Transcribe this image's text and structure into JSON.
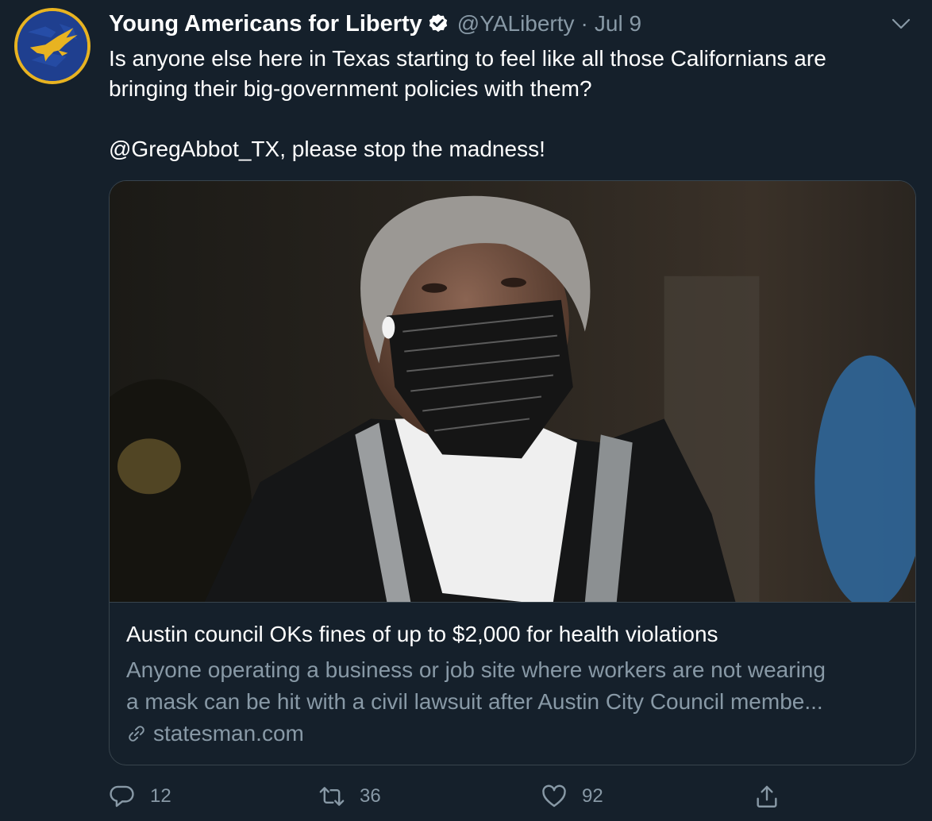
{
  "author": {
    "display_name": "Young Americans for Liberty",
    "handle": "@YALiberty",
    "separator": "·",
    "date": "Jul 9"
  },
  "tweet": {
    "lines": [
      "Is anyone else here in Texas starting to feel like all those Californians are",
      "bringing their big-government policies with them?",
      "@GregAbbot_TX, please stop the madness!"
    ]
  },
  "card": {
    "title": "Austin council OKs fines of up to $2,000 for health violations",
    "description_lines": [
      "Anyone operating a business or job site where workers are not wearing",
      "a mask can be hit with a civil lawsuit after Austin City Council membe..."
    ],
    "domain": "statesman.com"
  },
  "actions": {
    "reply_count": "12",
    "retweet_count": "36",
    "like_count": "92"
  },
  "colors": {
    "background": "#15202b",
    "text_primary": "#ffffff",
    "text_secondary": "#8899a6",
    "border": "#38444d",
    "verified": "#ffffff"
  },
  "icons": {
    "avatar": "eagle-logo",
    "verified": "verified-badge-icon",
    "menu": "chevron-down-icon",
    "link": "link-icon",
    "reply": "reply-icon",
    "retweet": "retweet-icon",
    "like": "heart-icon",
    "share": "share-icon"
  }
}
